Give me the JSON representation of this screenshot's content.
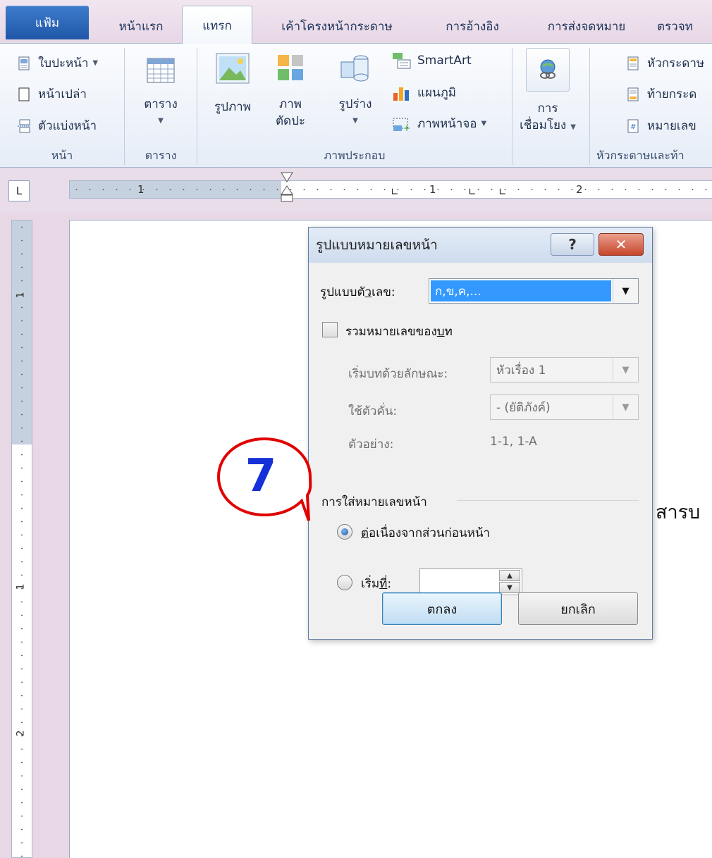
{
  "tabs": {
    "file": "แฟ้ม",
    "home": "หน้าแรก",
    "insert": "แทรก",
    "page_layout": "เค้าโครงหน้ากระดาษ",
    "references": "การอ้างอิง",
    "mailings": "การส่งจดหมาย",
    "review": "ตรวจท"
  },
  "ribbon": {
    "pages": {
      "cover_page": "ใบปะหน้า",
      "blank_page": "หน้าเปล่า",
      "page_break": "ตัวแบ่งหน้า",
      "label": "หน้า"
    },
    "tables": {
      "table": "ตาราง",
      "label": "ตาราง"
    },
    "illustrations": {
      "picture": "รูปภาพ",
      "clip_art_line1": "ภาพ",
      "clip_art_line2": "ตัดปะ",
      "shapes": "รูปร่าง",
      "smartart": "SmartArt",
      "chart": "แผนภูมิ",
      "screenshot": "ภาพหน้าจอ",
      "label": "ภาพประกอบ"
    },
    "links": {
      "line1": "การ",
      "line2": "เชื่อมโยง"
    },
    "header_footer": {
      "header": "หัวกระดาษ",
      "footer": "ท้ายกระด",
      "page_number": "หมายเลข",
      "label": "หัวกระดาษและท้า"
    }
  },
  "ruler": {
    "tab_selector": "L",
    "h_nums": [
      "1",
      "1",
      "2"
    ],
    "v_nums": [
      "1",
      "1",
      "2"
    ]
  },
  "document": {
    "text": "สารบ"
  },
  "dialog": {
    "title": "รูปแบบหมายเลขหน้า",
    "help": "?",
    "close": "✕",
    "number_format_label_pre": "รูปแบบตั",
    "number_format_label_ul": "ว",
    "number_format_label_post": "เลข:",
    "number_format_value": "ก,ข,ค,...",
    "include_chapter_pre": "รวมหมายเลขของ",
    "include_chapter_ul": "บ",
    "include_chapter_post": "ท",
    "chapter_style_label": "เริ่มบทด้วยลักษณะ:",
    "chapter_style_value": "หัวเรื่อง 1",
    "separator_label": "ใช้ตัวคั่น:",
    "separator_value": "-  (ยัติภังค์)",
    "examples_label": "ตัวอย่าง:",
    "examples_value": "1-1, 1-A",
    "page_numbering_label": "การใส่หมายเลขหน้า",
    "continue_ul": "ต่",
    "continue_post": "อเนื่องจากส่วนก่อนหน้า",
    "start_at_pre": "เริ่ม",
    "start_at_ul": "ที่",
    "start_at_post": ":",
    "start_at_value": "",
    "ok": "ตกลง",
    "cancel": "ยกเลิก"
  },
  "callout": {
    "number": "7",
    "color": "#e00000",
    "number_color": "#1530d8"
  }
}
